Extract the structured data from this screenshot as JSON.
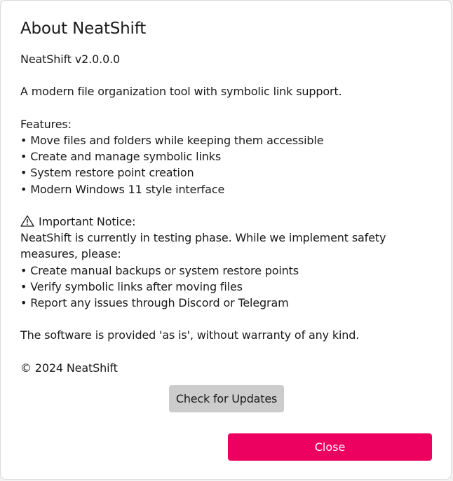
{
  "dialog": {
    "title": "About NeatShift",
    "version": "NeatShift v2.0.0.0",
    "description": "A modern file organization tool with symbolic link support.",
    "features_heading": "Features:",
    "features": [
      "• Move files and folders while keeping them accessible",
      "• Create and manage symbolic links",
      "• System restore point creation",
      "• Modern Windows 11 style interface"
    ],
    "notice": {
      "icon": "warning-icon",
      "heading": "Important Notice:",
      "text": "NeatShift is currently in testing phase. While we implement safety measures, please:",
      "items": [
        "• Create manual backups or system restore points",
        "• Verify symbolic links after moving files",
        "• Report any issues through Discord or Telegram"
      ]
    },
    "disclaimer": "The software is provided 'as is', without warranty of any kind.",
    "copyright": "© 2024 NeatShift",
    "check_updates_label": "Check for Updates",
    "close_label": "Close",
    "accent_color": "#ec0060"
  }
}
